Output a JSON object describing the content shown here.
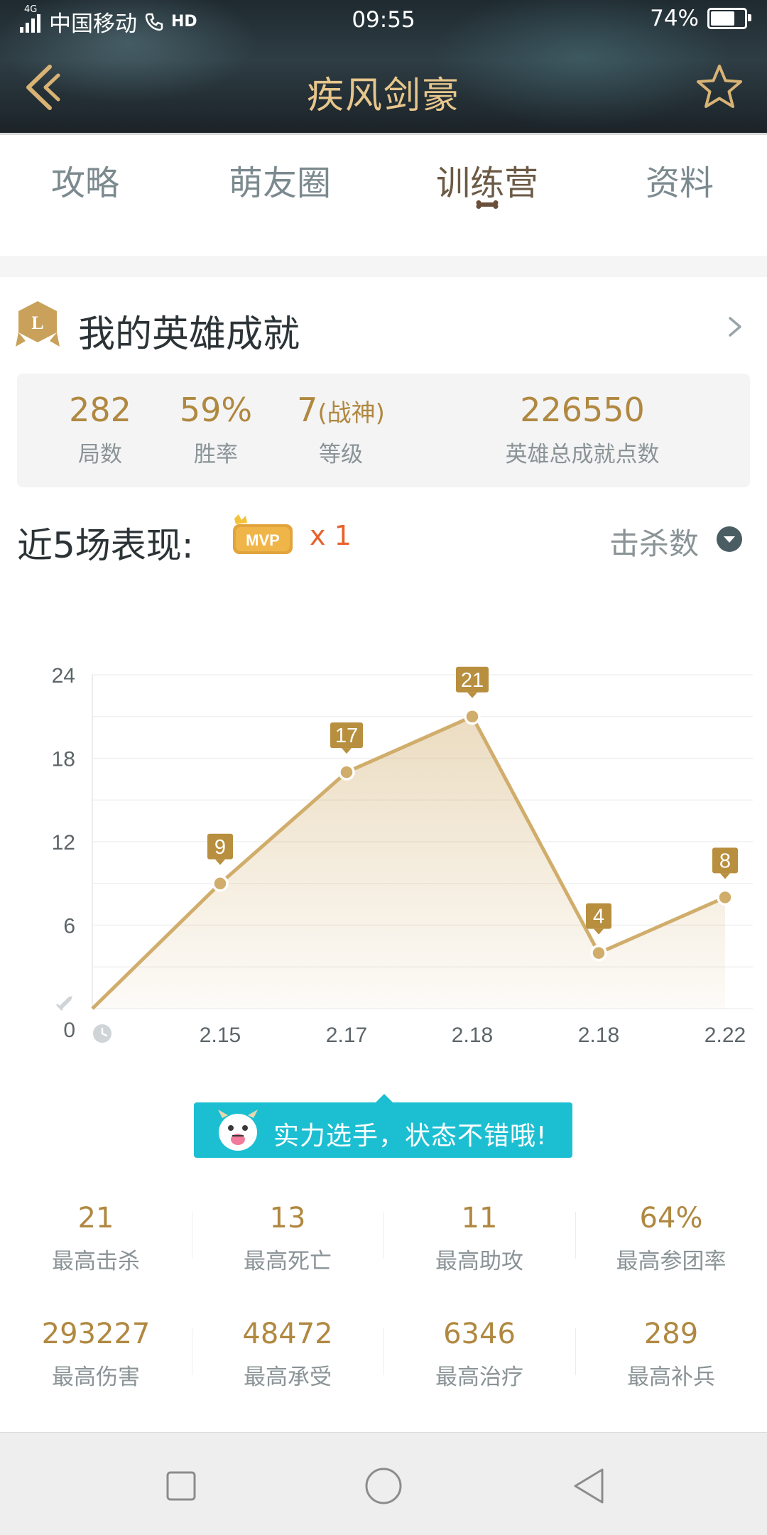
{
  "status_bar": {
    "network": "4G",
    "carrier": "中国移动",
    "hd": "HD",
    "time": "09:55",
    "battery": "74%",
    "battery_level": 0.74
  },
  "header": {
    "title": "疾风剑豪",
    "back_icon": "chevron-left-double-icon",
    "favorite_icon": "star-outline-icon"
  },
  "tabs": [
    {
      "label": "攻略"
    },
    {
      "label": "萌友圈"
    },
    {
      "label": "训练营",
      "active": true
    },
    {
      "label": "资料"
    }
  ],
  "achievements": {
    "title": "我的英雄成就",
    "badge_letter": "L",
    "stats": [
      {
        "value": "282",
        "label": "局数"
      },
      {
        "value": "59%",
        "label": "胜率"
      },
      {
        "value": "7",
        "suffix": "(战神)",
        "label": "等级"
      },
      {
        "value": "226550",
        "label": "英雄总成就点数"
      }
    ]
  },
  "recent": {
    "title": "近5场表现:",
    "mvp_label": "MVP",
    "mvp_count": "x 1",
    "metric": "击杀数"
  },
  "chart_data": {
    "type": "area",
    "x": [
      "",
      "2.15",
      "2.17",
      "2.18",
      "2.18",
      "2.22"
    ],
    "values": [
      0,
      9,
      17,
      21,
      4,
      8
    ],
    "point_labels": [
      "",
      "9",
      "17",
      "21",
      "4",
      "8"
    ],
    "yticks": [
      "0",
      "6",
      "12",
      "18",
      "24"
    ],
    "ylim": [
      0,
      24
    ],
    "color": "#d1ad6c",
    "label_color": "#b88f3e"
  },
  "tip": {
    "text": "实力选手，状态不错哦!"
  },
  "best_stats": [
    {
      "value": "21",
      "label": "最高击杀"
    },
    {
      "value": "13",
      "label": "最高死亡"
    },
    {
      "value": "11",
      "label": "最高助攻"
    },
    {
      "value": "64%",
      "label": "最高参团率"
    },
    {
      "value": "293227",
      "label": "最高伤害"
    },
    {
      "value": "48472",
      "label": "最高承受"
    },
    {
      "value": "6346",
      "label": "最高治疗"
    },
    {
      "value": "289",
      "label": "最高补兵"
    }
  ],
  "nav": {
    "recents_icon": "square-icon",
    "home_icon": "circle-icon",
    "back_icon": "triangle-back-icon"
  }
}
